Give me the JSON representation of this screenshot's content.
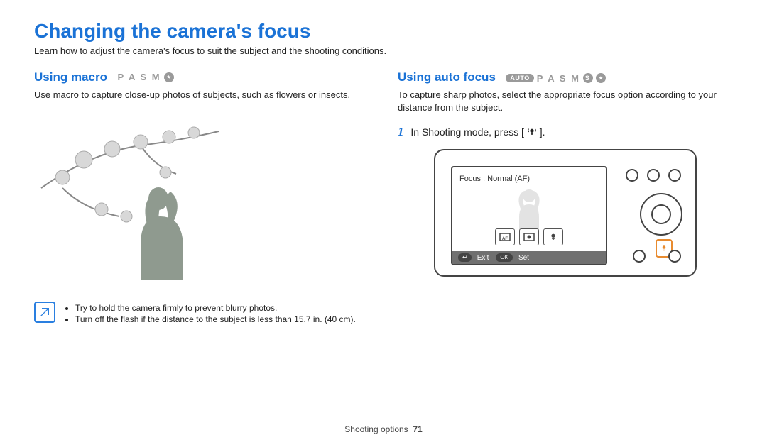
{
  "page": {
    "title": "Changing the camera's focus",
    "intro": "Learn how to adjust the camera's focus to suit the subject and the shooting conditions."
  },
  "left": {
    "heading": "Using macro",
    "modes": "P A S M",
    "body": "Use macro to capture close-up photos of subjects, such as flowers or insects.",
    "notes": [
      "Try to hold the camera firmly to prevent blurry photos.",
      "Turn off the flash if the distance to the subject is less than 15.7 in. (40 cm)."
    ]
  },
  "right": {
    "heading": "Using auto focus",
    "mode_pill": "AUTO",
    "modes": "P A S M",
    "body": "To capture sharp photos, select the appropriate focus option according to your distance from the subject.",
    "step1_num": "1",
    "step1_text_before": "In Shooting mode, press [",
    "step1_text_after": "].",
    "screen": {
      "label": "Focus : Normal (AF)",
      "exit_label": "Exit",
      "set_label": "Set",
      "exit_key": "↩",
      "set_key": "OK"
    }
  },
  "footer": {
    "section": "Shooting options",
    "page_number": "71"
  }
}
